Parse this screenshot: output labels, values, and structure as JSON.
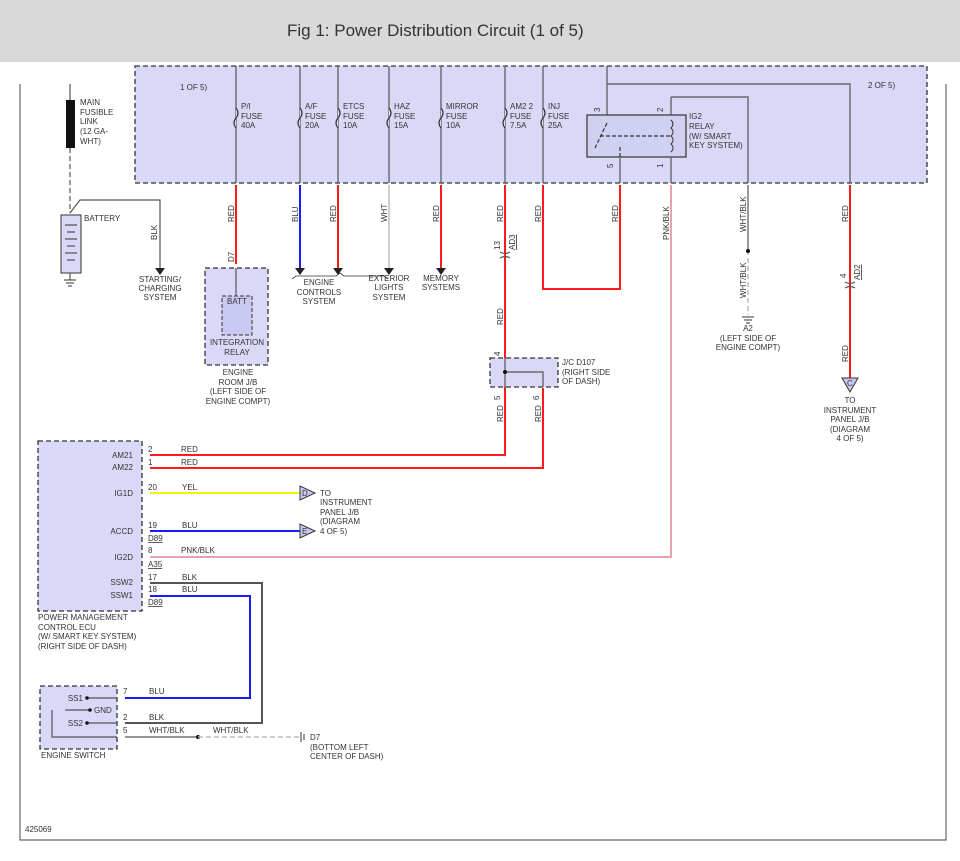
{
  "header": {
    "title": "Fig 1: Power Distribution Circuit (1 of 5)"
  },
  "diagram": {
    "page_ref_left": "1 OF 5)",
    "page_ref_right": "2 OF 5)",
    "main_fusible_link": [
      "MAIN",
      "FUSIBLE",
      "LINK",
      "(12 GA-",
      "WHT)"
    ],
    "battery": "BATTERY",
    "battery_wire": "BLK",
    "fuses": [
      {
        "name": "P/I",
        "label": "FUSE",
        "rating": "40A",
        "wire": "RED"
      },
      {
        "name": "A/F",
        "label": "FUSE",
        "rating": "20A",
        "wire": "BLU"
      },
      {
        "name": "ETCS",
        "label": "FUSE",
        "rating": "10A",
        "wire": "RED"
      },
      {
        "name": "HAZ",
        "label": "FUSE",
        "rating": "15A",
        "wire": "WHT"
      },
      {
        "name": "MIRROR",
        "label": "FUSE",
        "rating": "10A",
        "wire": "RED"
      },
      {
        "name": "AM2 2",
        "label": "FUSE",
        "rating": "7.5A",
        "wire": "RED"
      },
      {
        "name": "INJ",
        "label": "FUSE",
        "rating": "25A",
        "wire": "RED"
      }
    ],
    "relay": {
      "lines": [
        "IG2",
        "RELAY",
        "(W/ SMART",
        "KEY SYSTEM)"
      ],
      "pins": [
        "3",
        "2",
        "5",
        "1"
      ],
      "pin5_wire": "RED",
      "pin1_wire": "PNK/BLK"
    },
    "ground_wire": {
      "upper": "WHT/BLK",
      "lower": "WHT/BLK",
      "ground": [
        "A2",
        "(LEFT SIDE OF",
        "ENGINE COMPT)"
      ]
    },
    "right_wire": {
      "upper": "RED",
      "lower": "RED",
      "connector_pin": "4",
      "connector": "AD2",
      "marker": "C",
      "dest": [
        "TO",
        "INSTRUMENT",
        "PANEL J/B",
        "(DIAGRAM",
        "4 OF 5)"
      ]
    },
    "destinations": {
      "starting": [
        "STARTING/",
        "CHARGING",
        "SYSTEM"
      ],
      "engine_controls": [
        "ENGINE",
        "CONTROLS",
        "SYSTEM"
      ],
      "exterior_lights": [
        "EXTERIOR",
        "LIGHTS",
        "SYSTEM"
      ],
      "memory": [
        "MEMORY",
        "SYSTEMS"
      ]
    },
    "integration_relay": {
      "connector": "D7",
      "inner": "BATT",
      "lines": [
        "INTEGRATION",
        "RELAY"
      ],
      "location": [
        "ENGINE",
        "ROOM J/B",
        "(LEFT SIDE OF",
        "ENGINE COMPT)"
      ]
    },
    "am2_connector": {
      "pin": "13",
      "name": "AD3",
      "wire": "RED"
    },
    "junction": {
      "lines": [
        "J/C D107",
        "(RIGHT SIDE",
        "OF DASH)"
      ],
      "pin_in": "4",
      "pin_out_a": "5",
      "pin_out_b": "6",
      "wire_a": "RED",
      "wire_b": "RED"
    },
    "ecu": {
      "pins": [
        {
          "name": "AM21",
          "num": "2",
          "wire": "RED"
        },
        {
          "name": "AM22",
          "num": "1",
          "wire": "RED"
        },
        {
          "name": "IG1D",
          "num": "20",
          "wire": "YEL"
        },
        {
          "name": "ACCD",
          "num": "19",
          "wire": "BLU",
          "conn": "D89"
        },
        {
          "name": "IG2D",
          "num": "8",
          "wire": "PNK/BLK",
          "conn": "A35"
        },
        {
          "name": "SSW2",
          "num": "17",
          "wire": "BLK"
        },
        {
          "name": "SSW1",
          "num": "18",
          "wire": "BLU",
          "conn": "D89"
        }
      ],
      "lines": [
        "POWER MANAGEMENT",
        "CONTROL ECU",
        "(W/ SMART KEY SYSTEM)",
        "(RIGHT SIDE OF DASH)"
      ]
    },
    "ip_jb": {
      "marker_d": "D",
      "marker_e": "E",
      "lines": [
        "TO",
        "INSTRUMENT",
        "PANEL J/B",
        "(DIAGRAM",
        "4 OF 5)"
      ]
    },
    "engine_switch": {
      "title": "ENGINE SWITCH",
      "pins": [
        {
          "name": "SS1",
          "num": "7",
          "wire": "BLU"
        },
        {
          "name": "GND"
        },
        {
          "name": "SS2",
          "num": "2",
          "wire": "BLK"
        },
        {
          "num": "5",
          "wire": "WHT/BLK"
        }
      ],
      "wire2": "WHT/BLK",
      "ground": [
        "D7",
        "(BOTTOM LEFT",
        "CENTER OF DASH)"
      ]
    },
    "figure_id": "425069"
  }
}
